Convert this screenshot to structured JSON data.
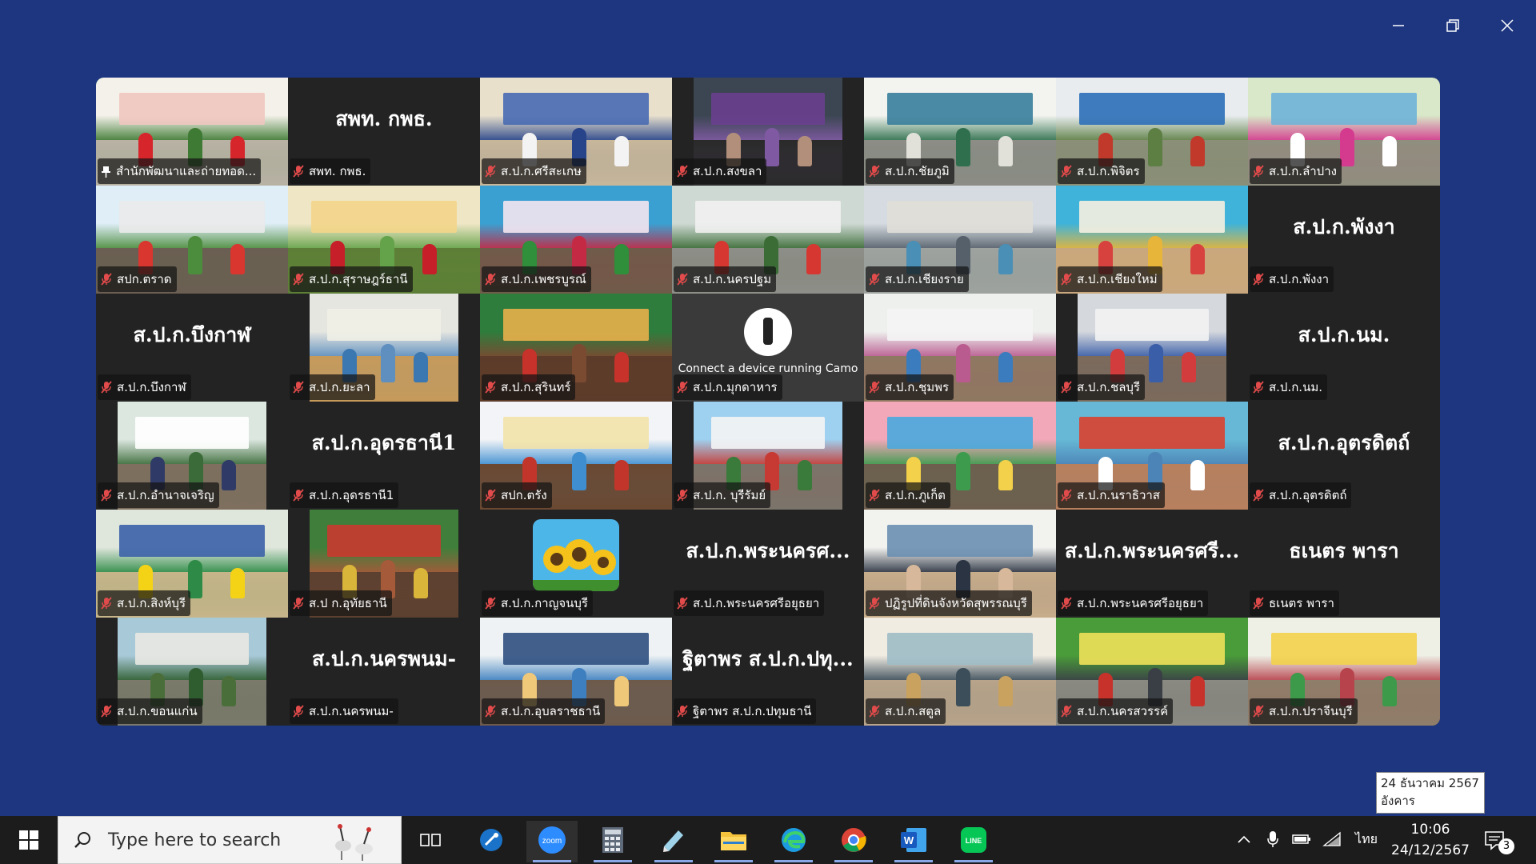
{
  "colors": {
    "desktop": "#1e3680",
    "active_speaker": "#2ad36b",
    "muted_mic": "#e24b4b"
  },
  "gallery": {
    "tiles": [
      {
        "label": "สำนักพัฒนาและถ่ายทอด...",
        "type": "video",
        "active": true,
        "pinned": true,
        "theme": "red-tent"
      },
      {
        "label": "สพท. กพธ.",
        "type": "name",
        "display": "สพท. กพธ."
      },
      {
        "label": "ส.ป.ก.ศรีสะเกษ",
        "type": "video",
        "theme": "market-blue"
      },
      {
        "label": "ส.ป.ก.สงขลา",
        "type": "video",
        "narrow": true,
        "theme": "office-purple"
      },
      {
        "label": "ส.ป.ก.ชัยภูมิ",
        "type": "video",
        "theme": "hall-green"
      },
      {
        "label": "ส.ป.ก.พิจิตร",
        "type": "video",
        "theme": "fair-outdoor"
      },
      {
        "label": "ส.ป.ก.ลำปาง",
        "type": "video",
        "theme": "pink-banner"
      },
      {
        "label": "สปก.ตราด",
        "type": "video",
        "theme": "fruit-banner"
      },
      {
        "label": "ส.ป.ก.สุราษฎร์ธานี",
        "type": "video",
        "theme": "santa-banner"
      },
      {
        "label": "ส.ป.ก.เพชรบูรณ์",
        "type": "video",
        "theme": "xmas-stage"
      },
      {
        "label": "ส.ป.ก.นครปฐม",
        "type": "video",
        "theme": "parking-red"
      },
      {
        "label": "ส.ป.ก.เชียงราย",
        "type": "video",
        "theme": "hall-grey"
      },
      {
        "label": "ส.ป.ก.เชียงใหม่",
        "type": "video",
        "theme": "booth-colorful"
      },
      {
        "label": "ส.ป.ก.พังงา",
        "type": "name",
        "display": "ส.ป.ก.พังงา"
      },
      {
        "label": "ส.ป.ก.บึงกาฬ",
        "type": "name",
        "display": "ส.ป.ก.บึงกาฬ"
      },
      {
        "label": "ส.ป.ก.ยะลา",
        "type": "video",
        "narrow": true,
        "theme": "office-desk"
      },
      {
        "label": "ส.ป.ก.สุรินทร์",
        "type": "video",
        "theme": "market-produce"
      },
      {
        "label": "ส.ป.ก.มุกดาหาร",
        "type": "camo",
        "camo_text": "Connect a device running Camo"
      },
      {
        "label": "ส.ป.ก.ชุมพร",
        "type": "video",
        "theme": "office-pink"
      },
      {
        "label": "ส.ป.ก.ชลบุรี",
        "type": "video",
        "narrow": true,
        "theme": "stage-flags"
      },
      {
        "label": "ส.ป.ก.นม.",
        "type": "name",
        "display": "ส.ป.ก.นม."
      },
      {
        "label": "ส.ป.ก.อำนาจเจริญ",
        "type": "video",
        "narrow": true,
        "theme": "tree-man"
      },
      {
        "label": "ส.ป.ก.อุดรธานี1",
        "type": "name",
        "display": "ส.ป.ก.อุดรธานี1"
      },
      {
        "label": "สปก.ตรัง",
        "type": "video",
        "theme": "banner-produce"
      },
      {
        "label": "ส.ป.ก. บุรีรัมย์",
        "type": "video",
        "narrow": true,
        "theme": "tent-red"
      },
      {
        "label": "ส.ป.ก.ภูเก็ต",
        "type": "video",
        "theme": "stage-balloons"
      },
      {
        "label": "ส.ป.ก.นราธิวาส",
        "type": "video",
        "theme": "meeting-banner"
      },
      {
        "label": "ส.ป.ก.อุตรดิตถ์",
        "type": "name",
        "display": "ส.ป.ก.อุตรดิตถ์"
      },
      {
        "label": "ส.ป.ก.สิงห์บุรี",
        "type": "video",
        "theme": "office-yellow"
      },
      {
        "label": "ส.ป ก.อุทัยธานี",
        "type": "video",
        "narrow": true,
        "theme": "booth-xmas"
      },
      {
        "label": "ส.ป.ก.กาญจนบุรี",
        "type": "sunflower"
      },
      {
        "label": "ส.ป.ก.พระนครศรีอยุธยา",
        "type": "name",
        "display": "ส.ป.ก.พระนครศ..."
      },
      {
        "label": "ปฏิรูปที่ดินจังหวัดสุพรรณบุรี",
        "type": "video",
        "theme": "man-glasses"
      },
      {
        "label": "ส.ป.ก.พระนครศรีอยุธยา",
        "type": "name",
        "display": "ส.ป.ก.พระนครศรี..."
      },
      {
        "label": "ธเนตร พารา",
        "type": "name",
        "display": "ธเนตร พารา"
      },
      {
        "label": "ส.ป.ก.ขอนแก่น",
        "type": "video",
        "narrow": true,
        "theme": "trees-crowd"
      },
      {
        "label": "ส.ป.ก.นครพนม-",
        "type": "name",
        "display": "ส.ป.ก.นครพนม-"
      },
      {
        "label": "ส.ป.ก.อุบลราชธานี",
        "type": "video",
        "theme": "speaker-mic"
      },
      {
        "label": "ฐิตาพร ส.ป.ก.ปทุมธานี",
        "type": "name",
        "display": "ฐิตาพร ส.ป.ก.ปทุ..."
      },
      {
        "label": "ส.ป.ก.สตูล",
        "type": "video",
        "theme": "shop-man"
      },
      {
        "label": "ส.ป.ก.นครสวรรค์",
        "type": "video",
        "theme": "green-tent"
      },
      {
        "label": "ส.ป.ก.ปราจีนบุรี",
        "type": "video",
        "theme": "poster-fair"
      }
    ]
  },
  "date_popup": {
    "date": "24 ธันวาคม 2567",
    "weekday": "อังคาร"
  },
  "taskbar": {
    "search_placeholder": "Type here to search",
    "apps": [
      {
        "name": "task-view-icon"
      },
      {
        "name": "browser-shortcut-icon"
      },
      {
        "name": "zoom-icon",
        "active": true
      },
      {
        "name": "calculator-icon"
      },
      {
        "name": "notepad-icon"
      },
      {
        "name": "file-explorer-icon"
      },
      {
        "name": "edge-icon"
      },
      {
        "name": "chrome-icon"
      },
      {
        "name": "word-icon"
      },
      {
        "name": "line-icon"
      }
    ],
    "tray": {
      "language": "ไทย",
      "time": "10:06",
      "date": "24/12/2567",
      "notifications": "3"
    }
  }
}
